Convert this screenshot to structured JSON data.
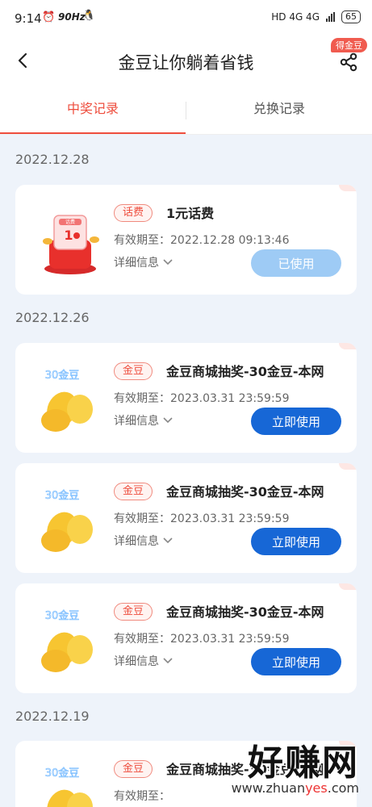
{
  "status_bar": {
    "time": "9:14",
    "refresh_rate": "90Hz",
    "network": "HD 4G 4G",
    "battery": "65"
  },
  "header": {
    "title": "金豆让你躺着省钱",
    "share_badge": "得金豆"
  },
  "tabs": [
    {
      "label": "中奖记录",
      "active": true
    },
    {
      "label": "兑换记录",
      "active": false
    }
  ],
  "groups": [
    {
      "date": "2022.12.28",
      "records": [
        {
          "tag": "话费",
          "title": "1元话费",
          "expiry": "有效期至：2022.12.28 09:13:46",
          "details": "详细信息",
          "button": "已使用",
          "icon": "phone-credit-coupon-icon"
        }
      ]
    },
    {
      "date": "2022.12.26",
      "records": [
        {
          "tag": "金豆",
          "title": "金豆商城抽奖-30金豆-本网",
          "expiry": "有效期至：2023.03.31 23:59:59",
          "details": "详细信息",
          "button": "立即使用",
          "icon": "gold-beans-icon",
          "icon_label": "30金豆"
        },
        {
          "tag": "金豆",
          "title": "金豆商城抽奖-30金豆-本网",
          "expiry": "有效期至：2023.03.31 23:59:59",
          "details": "详细信息",
          "button": "立即使用",
          "icon": "gold-beans-icon",
          "icon_label": "30金豆"
        },
        {
          "tag": "金豆",
          "title": "金豆商城抽奖-30金豆-本网",
          "expiry": "有效期至：2023.03.31 23:59:59",
          "details": "详细信息",
          "button": "立即使用",
          "icon": "gold-beans-icon",
          "icon_label": "30金豆"
        }
      ]
    },
    {
      "date": "2022.12.19",
      "records": [
        {
          "tag": "金豆",
          "title": "金豆商城抽奖-30金豆-本网",
          "expiry": "有效期至：",
          "details": "",
          "button": "",
          "icon": "gold-beans-icon",
          "icon_label": "30金豆"
        }
      ]
    }
  ],
  "watermark": {
    "text": "好赚网",
    "url_prefix": "www.zhuan",
    "url_highlight": "yes",
    "url_suffix": ".com"
  },
  "colors": {
    "accent": "#ee4d3d",
    "primary_button": "#1767d6",
    "used_button": "#9ecbf5",
    "page_bg": "#eef3fa"
  }
}
